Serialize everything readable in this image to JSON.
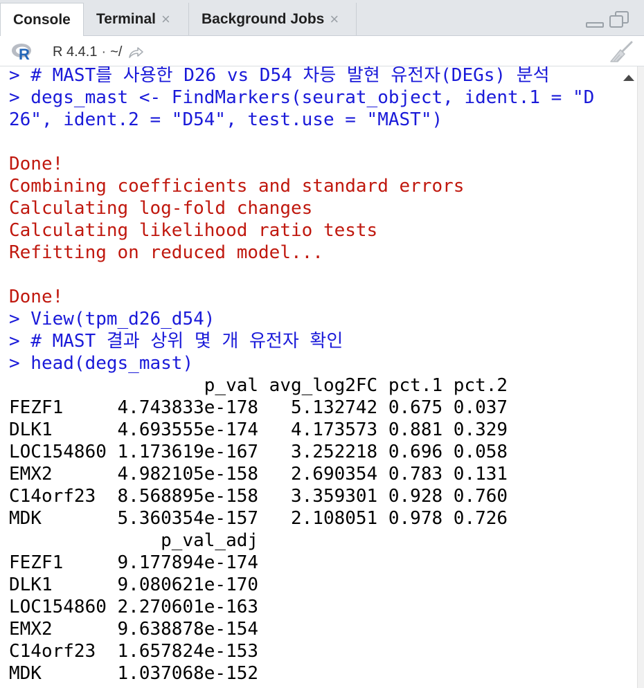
{
  "tabs": [
    {
      "label": "Console",
      "active": true,
      "closable": false
    },
    {
      "label": "Terminal",
      "active": false,
      "closable": true
    },
    {
      "label": "Background Jobs",
      "active": false,
      "closable": true
    }
  ],
  "toolbar": {
    "r_version": "R 4.4.1",
    "separator": "·",
    "working_dir": "~/"
  },
  "console": {
    "lines": [
      {
        "type": "cmd",
        "text": "> # MAST를 사용한 D26 vs D54 차등 발현 유전자(DEGs) 분석"
      },
      {
        "type": "cmd",
        "text": "> degs_mast <- FindMarkers(seurat_object, ident.1 = \"D"
      },
      {
        "type": "cmd",
        "text": "26\", ident.2 = \"D54\", test.use = \"MAST\")"
      },
      {
        "type": "out",
        "text": ""
      },
      {
        "type": "msg",
        "text": "Done!"
      },
      {
        "type": "msg",
        "text": "Combining coefficients and standard errors"
      },
      {
        "type": "msg",
        "text": "Calculating log-fold changes"
      },
      {
        "type": "msg",
        "text": "Calculating likelihood ratio tests"
      },
      {
        "type": "msg",
        "text": "Refitting on reduced model..."
      },
      {
        "type": "out",
        "text": ""
      },
      {
        "type": "msg",
        "text": "Done!"
      },
      {
        "type": "cmd",
        "text": "> View(tpm_d26_d54)"
      },
      {
        "type": "cmd",
        "text": "> # MAST 결과 상위 몇 개 유전자 확인"
      },
      {
        "type": "cmd",
        "text": "> head(degs_mast)"
      },
      {
        "type": "out",
        "text": "                  p_val avg_log2FC pct.1 pct.2"
      },
      {
        "type": "out",
        "text": "FEZF1     4.743833e-178   5.132742 0.675 0.037"
      },
      {
        "type": "out",
        "text": "DLK1      4.693555e-174   4.173573 0.881 0.329"
      },
      {
        "type": "out",
        "text": "LOC154860 1.173619e-167   3.252218 0.696 0.058"
      },
      {
        "type": "out",
        "text": "EMX2      4.982105e-158   2.690354 0.783 0.131"
      },
      {
        "type": "out",
        "text": "C14orf23  8.568895e-158   3.359301 0.928 0.760"
      },
      {
        "type": "out",
        "text": "MDK       5.360354e-157   2.108051 0.978 0.726"
      },
      {
        "type": "out",
        "text": "              p_val_adj"
      },
      {
        "type": "out",
        "text": "FEZF1     9.177894e-174"
      },
      {
        "type": "out",
        "text": "DLK1      9.080621e-170"
      },
      {
        "type": "out",
        "text": "LOC154860 2.270601e-163"
      },
      {
        "type": "out",
        "text": "EMX2      9.638878e-154"
      },
      {
        "type": "out",
        "text": "C14orf23  1.657824e-153"
      },
      {
        "type": "out",
        "text": "MDK       1.037068e-152"
      }
    ]
  },
  "colors": {
    "command": "#1a1ad9",
    "message": "#c0180e",
    "output": "#000000",
    "tabbar_bg": "#e3e6ea"
  },
  "icons": {
    "r_logo": "r-logo-icon",
    "share": "share-arrow-icon",
    "clear": "broom-icon",
    "minimize": "minimize-icon",
    "maximize": "maximize-icon"
  }
}
